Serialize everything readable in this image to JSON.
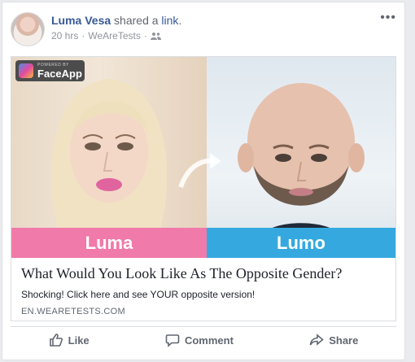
{
  "post": {
    "author": "Luma Vesa",
    "action_prefix": "shared a",
    "action_link": "link",
    "action_suffix": ".",
    "time": "20 hrs",
    "separator": "·",
    "source": "WeAreTests",
    "audience_icon": "friends-icon",
    "more_label": "•••"
  },
  "link_card": {
    "badge_small": "POWERED BY",
    "badge_main": "FaceApp",
    "left_label": "Luma",
    "right_label": "Lumo",
    "title": "What Would You Look Like As The Opposite Gender?",
    "description": "Shocking! Click here and see YOUR opposite version!",
    "domain": "EN.WEARETESTS.COM",
    "colors": {
      "left_bar": "#f07aaa",
      "right_bar": "#35a9df"
    }
  },
  "actions": [
    {
      "label": "Like",
      "icon": "thumbs-up-icon"
    },
    {
      "label": "Comment",
      "icon": "comment-icon"
    },
    {
      "label": "Share",
      "icon": "share-icon"
    }
  ]
}
